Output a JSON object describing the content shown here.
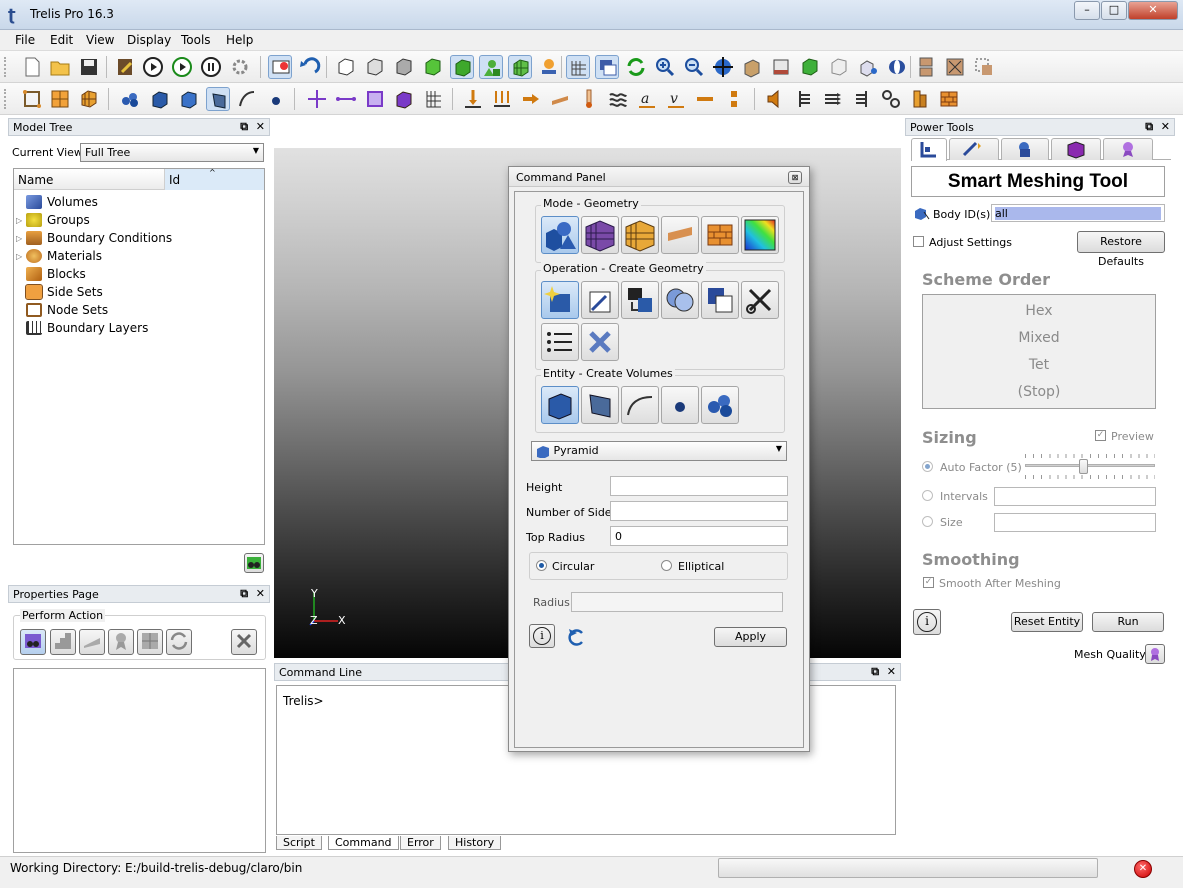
{
  "window": {
    "title": "Trelis Pro  16.3",
    "min": "–",
    "max": "□",
    "close": "✕"
  },
  "menu": [
    "File",
    "Edit",
    "View",
    "Display",
    "Tools",
    "Help"
  ],
  "model_tree": {
    "title": "Model Tree",
    "current_view_label": "Current View",
    "current_view_value": "Full Tree",
    "col_name": "Name",
    "col_id": "Id",
    "items": [
      "Volumes",
      "Groups",
      "Boundary Conditions",
      "Materials",
      "Blocks",
      "Side Sets",
      "Node Sets",
      "Boundary Layers"
    ]
  },
  "properties": {
    "title": "Properties Page",
    "perform_action": "Perform Action"
  },
  "viewport": {
    "axis_x": "X",
    "axis_y": "Y",
    "axis_z": "Z"
  },
  "command_panel": {
    "title": "Command Panel",
    "mode_label": "Mode - Geometry",
    "operation_label": "Operation - Create Geometry",
    "entity_label": "Entity - Create Volumes",
    "shape_value": "Pyramid",
    "height_label": "Height",
    "height_value": "",
    "sides_label": "Number of Sides",
    "sides_value": "",
    "top_radius_label": "Top Radius",
    "top_radius_value": "0",
    "circular_label": "Circular",
    "elliptical_label": "Elliptical",
    "radius_label": "Radius",
    "radius_value": "",
    "info_glyph": "i",
    "apply_label": "Apply"
  },
  "command_line": {
    "title": "Command Line",
    "prompt": "Trelis>",
    "tabs": [
      "Script",
      "Command",
      "Error",
      "History"
    ]
  },
  "power_tools": {
    "title": "Power Tools",
    "heading": "Smart Meshing Tool",
    "body_ids_label": "Body ID(s)",
    "body_ids_value": "all",
    "adjust_settings_label": "Adjust Settings",
    "restore_defaults_label": "Restore Defaults",
    "scheme_order_label": "Scheme Order",
    "schemes": [
      "Hex",
      "Mixed",
      "Tet",
      "(Stop)"
    ],
    "sizing_label": "Sizing",
    "preview_label": "Preview",
    "auto_factor_label": "Auto Factor (5)",
    "auto_factor_value": 5,
    "intervals_label": "Intervals",
    "size_label": "Size",
    "smoothing_label": "Smoothing",
    "smooth_after_label": "Smooth After Meshing",
    "info_glyph": "i",
    "reset_entity_label": "Reset Entity",
    "run_label": "Run",
    "mesh_quality_label": "Mesh Quality"
  },
  "status": {
    "working_dir": "Working Directory: E:/build-trelis-debug/claro/bin"
  },
  "colors": {
    "accent": "#3b6fb6",
    "selection": "#aabfe8",
    "viewport_top": "#d9d9d9",
    "viewport_bottom": "#050505"
  }
}
